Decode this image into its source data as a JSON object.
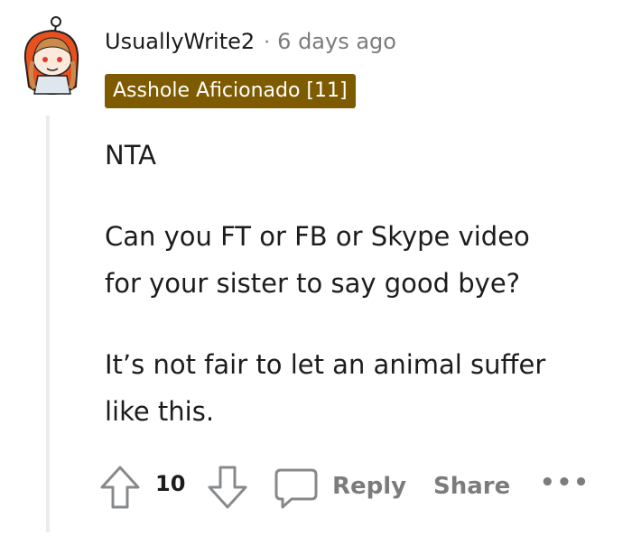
{
  "comment": {
    "username": "UsuallyWrite2",
    "separator": "·",
    "timestamp": "6 days ago",
    "flair": "Asshole Aficionado [11]",
    "body": {
      "line1": "NTA",
      "line2": "Can you FT or FB or Skype video",
      "line3": "for your sister to say good bye?",
      "line4": "It’s not fair to let an animal suffer",
      "line5": "like this."
    },
    "colors": {
      "flair_bg": "#7e5b00",
      "meta_text": "#7c7c7c",
      "text": "#1c1c1c",
      "avatar_hood": "#e8501e"
    }
  },
  "actions": {
    "score": "10",
    "reply_label": "Reply",
    "share_label": "Share",
    "more_label": "•••",
    "icons": {
      "upvote": "upvote-arrow-icon",
      "downvote": "downvote-arrow-icon",
      "reply": "speech-bubble-icon",
      "more": "ellipsis-icon"
    }
  }
}
